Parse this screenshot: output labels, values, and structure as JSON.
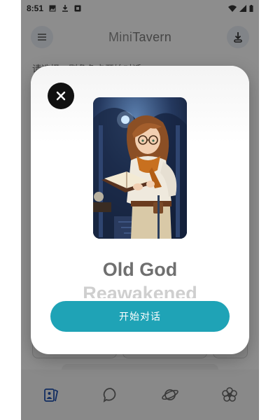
{
  "status": {
    "time": "8:51"
  },
  "app": {
    "title_prefix": "Mini",
    "title_suffix": "Tavern",
    "prompt": "请选择一则角色卡开始对话："
  },
  "modal": {
    "name_line1": "Old God",
    "name_line2": "Reawakened",
    "start_label": "开始对话"
  },
  "bottom_nav": [
    {
      "icon": "cards-icon"
    },
    {
      "icon": "chat-bubble-icon"
    },
    {
      "icon": "planet-icon"
    },
    {
      "icon": "settings-flower-icon"
    }
  ],
  "colors": {
    "accent": "#1fa3b6",
    "scrim": "#000000"
  }
}
